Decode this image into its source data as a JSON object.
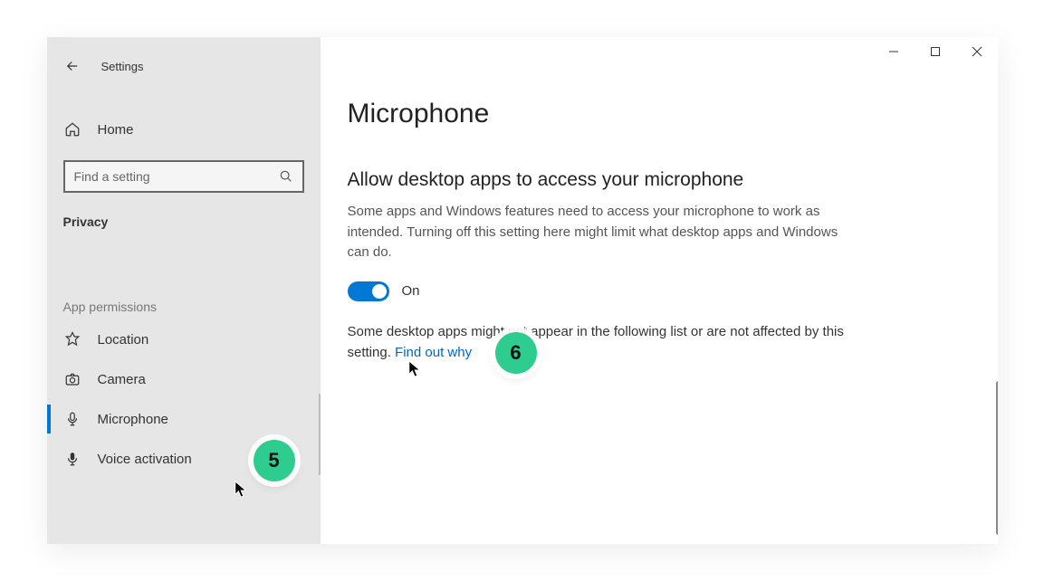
{
  "header": {
    "title": "Settings"
  },
  "sidebar": {
    "home": "Home",
    "search_placeholder": "Find a setting",
    "privacy_label": "Privacy",
    "permissions_label": "App permissions",
    "items": [
      {
        "label": "Location"
      },
      {
        "label": "Camera"
      },
      {
        "label": "Microphone"
      },
      {
        "label": "Voice activation"
      }
    ]
  },
  "main": {
    "page_title": "Microphone",
    "section_heading": "Allow desktop apps to access your microphone",
    "description": "Some apps and Windows features need to access your microphone to work as intended. Turning off this setting here might limit what desktop apps and Windows can do.",
    "toggle_label": "On",
    "footnote_prefix": "Some desktop apps might not appear in the following list or are not affected by this setting. ",
    "footnote_link": "Find out why"
  },
  "badges": {
    "b5": "5",
    "b6": "6"
  }
}
